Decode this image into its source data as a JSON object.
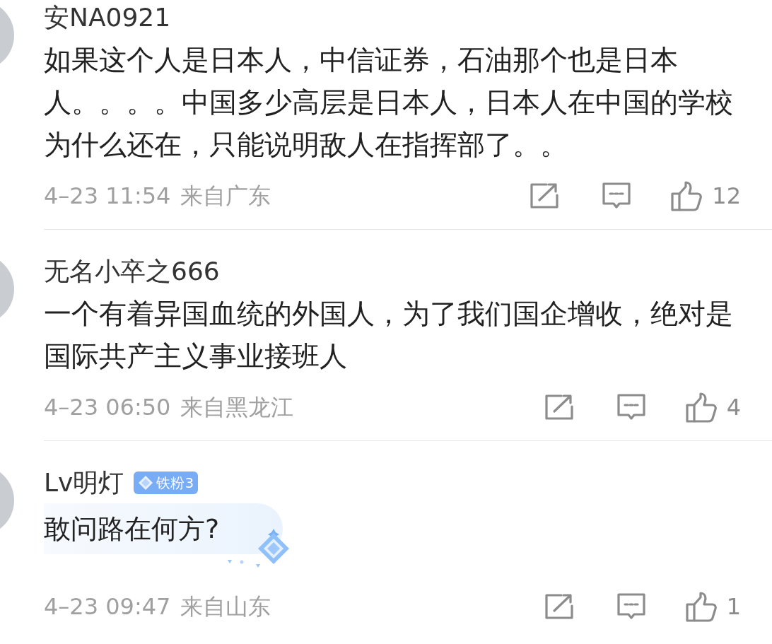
{
  "comments": [
    {
      "user": "安NA0921",
      "text": "如果这个人是日本人，中信证券，石油那个也是日本人。。。。中国多少高层是日本人，日本人在中国的学校为什么还在，只能说明敌人在指挥部了。。",
      "time": "4–23 11:54",
      "location": "来自广东",
      "likes": "12",
      "bubble": false
    },
    {
      "user": "无名小卒之666",
      "text": "一个有着异国血统的外国人，为了我们国企增收，绝对是国际共产主义事业接班人",
      "time": "4–23 06:50",
      "location": "来自黑龙江",
      "likes": "4",
      "bubble": false
    },
    {
      "user": "Lv明灯",
      "badge": "铁粉3",
      "text": "敢问路在何方?",
      "time": "4–23 09:47",
      "location": "来自山东",
      "likes": "1",
      "bubble": true
    }
  ]
}
